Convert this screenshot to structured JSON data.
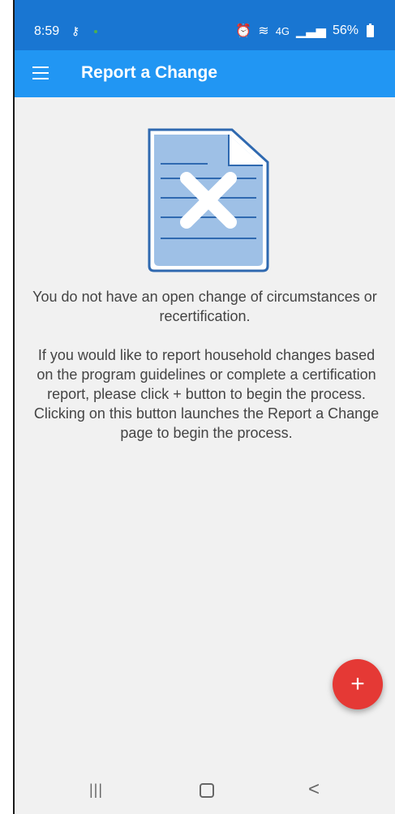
{
  "status_bar": {
    "time": "8:59",
    "key_icon": "key-icon",
    "alarm_icon": "alarm-icon",
    "wifi_label": "4G",
    "signal_icon": "signal-icon",
    "battery": "56%"
  },
  "app_bar": {
    "title": "Report a Change",
    "menu_icon": "hamburger-menu-icon"
  },
  "illustration": {
    "icon": "document-x-icon",
    "colors": {
      "page": "#9ec0e6",
      "line": "#2f69b0",
      "x": "#ffffff",
      "border": "#2f69b0"
    }
  },
  "messages": {
    "primary": "You do not have an open change of circumstances or recertification.",
    "secondary": "If you would like to report household changes based on the program guidelines or complete a certification report, please click + button to begin the process. Clicking on this button launches the Report a Change page to begin the process."
  },
  "fab": {
    "label": "+",
    "color": "#e53935"
  },
  "nav_bar": {
    "recent": "|||",
    "back": "<"
  },
  "colors": {
    "status_bar": "#1976d2",
    "app_bar": "#2196f3",
    "background": "#f1f1f1"
  }
}
